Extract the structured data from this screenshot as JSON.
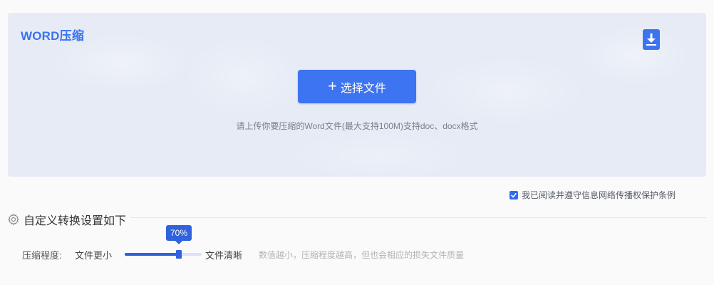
{
  "upload": {
    "title": "WORD压缩",
    "select_button_label": "选择文件",
    "hint": "请上传你要压缩的Word文件(最大支持100M)支持doc、docx格式"
  },
  "agreement": {
    "checked": true,
    "text": "我已阅读并遵守信息网络传播权保护条例"
  },
  "settings": {
    "title": "自定义转换设置如下",
    "compression": {
      "label": "压缩程度:",
      "min_label": "文件更小",
      "max_label": "文件清晰",
      "value": 70,
      "value_text": "70%",
      "note": "数值越小，压缩程度越高，但也会相应的损失文件质量"
    }
  },
  "colors": {
    "accent": "#3d74f2",
    "title": "#3a73f0",
    "slider": "#2f62dc",
    "panel_bg": "#e6ebf5"
  },
  "icons": {
    "download": "download-icon",
    "plus": "plus-icon",
    "gear": "gear-icon",
    "check": "check-icon"
  }
}
